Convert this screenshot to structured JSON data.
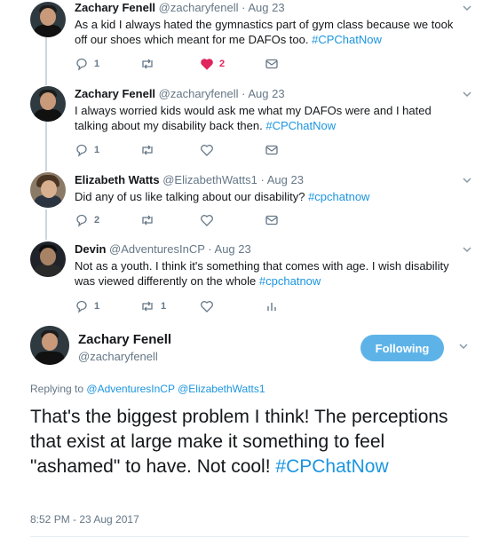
{
  "tweets": [
    {
      "name": "Zachary Fenell",
      "handle": "@zacharyfenell",
      "time": "Aug 23",
      "text": "As a kid I always hated the gymnastics part of gym class because we took off our shoes which meant for me DAFOs too.",
      "hashtag": "#CPChatNow",
      "replies": "1",
      "retweets": "",
      "likes": "2",
      "liked": true
    },
    {
      "name": "Zachary Fenell",
      "handle": "@zacharyfenell",
      "time": "Aug 23",
      "text": "I always worried kids would ask me what my DAFOs were and I hated talking about my disability back then.",
      "hashtag": "#CPChatNow",
      "replies": "1",
      "retweets": "",
      "likes": "",
      "liked": false
    },
    {
      "name": "Elizabeth Watts",
      "handle": "@ElizabethWatts1",
      "time": "Aug 23",
      "text": "Did any of us like talking about our disability?",
      "hashtag": "#cpchatnow",
      "replies": "2",
      "retweets": "",
      "likes": "",
      "liked": false
    },
    {
      "name": "Devin",
      "handle": "@AdventuresInCP",
      "time": "Aug 23",
      "text": "Not as a youth. I think it's something that comes with age. I wish disability was viewed differently on the whole",
      "hashtag": "#cpchatnow",
      "replies": "1",
      "retweets": "1",
      "likes": "",
      "liked": false
    }
  ],
  "main_tweet": {
    "name": "Zachary Fenell",
    "handle": "@zacharyfenell",
    "follow_label": "Following",
    "replying_label": "Replying to",
    "replying_to": [
      "@AdventuresInCP",
      "@ElizabethWatts1"
    ],
    "text": "That's the biggest problem I think! The perceptions that exist at large make it something to feel \"ashamed\" to have. Not cool!",
    "hashtag": "#CPChatNow",
    "timestamp": "8:52 PM - 23 Aug 2017"
  },
  "colors": {
    "link": "#1b95e0",
    "like": "#e0245e",
    "follow_button": "#5db3e8",
    "muted": "#657786"
  },
  "icons": {
    "reply": "reply-icon",
    "retweet": "retweet-icon",
    "like": "heart-icon",
    "dm": "envelope-icon",
    "analytics": "analytics-icon",
    "menu": "chevron-down-icon"
  }
}
